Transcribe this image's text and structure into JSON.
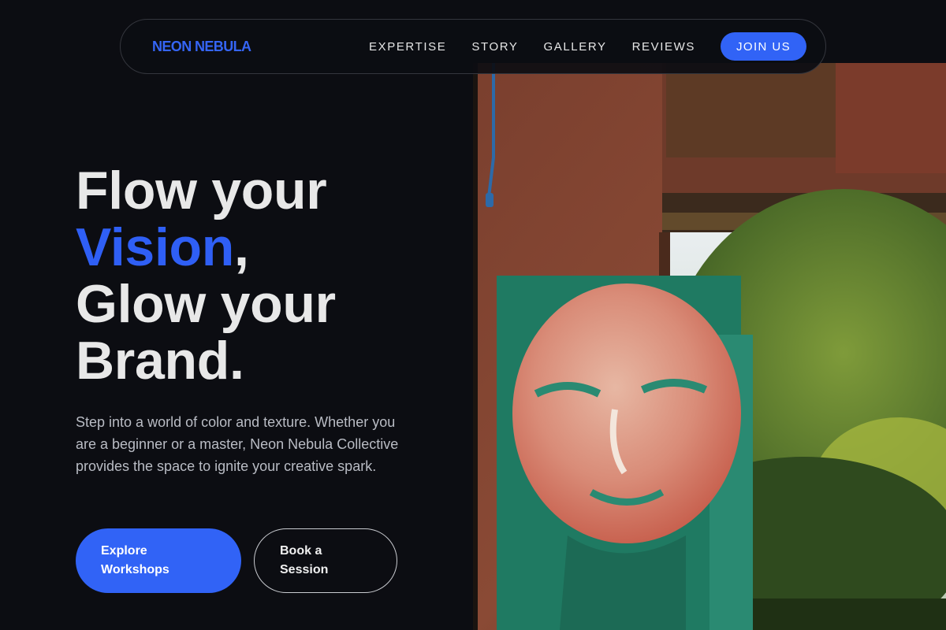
{
  "nav": {
    "brand": "NEON NEBULA",
    "links": [
      "EXPERTISE",
      "STORY",
      "GALLERY",
      "REVIEWS"
    ],
    "cta": "JOIN US"
  },
  "hero": {
    "headline_line1": "Flow your",
    "headline_accent": "Vision",
    "headline_comma": ",",
    "headline_line3": "Glow your",
    "headline_line4": "Brand.",
    "lead": "Step into a world of color and texture. Whether you are a beginner or a master, Neon Nebula Collective provides the space to ignite your creative spark.",
    "primary_cta_line1": "Explore",
    "primary_cta_line2": "Workshops",
    "secondary_cta_line1": "Book a",
    "secondary_cta_line2": "Session"
  },
  "colors": {
    "background": "#0c0d12",
    "accent": "#3163f6",
    "text": "#e8e8e8",
    "muted": "#b9bcc4"
  }
}
